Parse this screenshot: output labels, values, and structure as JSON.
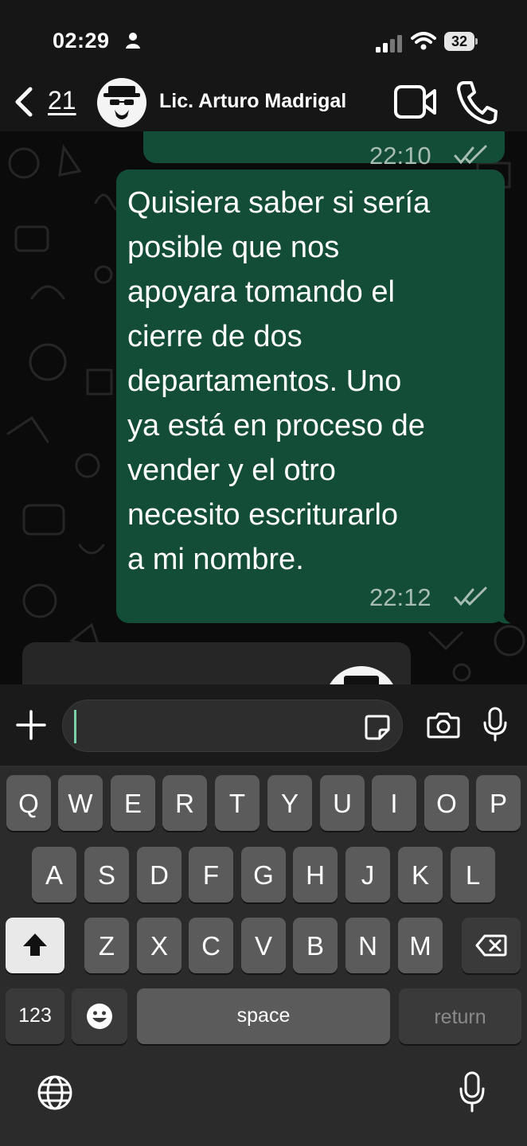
{
  "status_bar": {
    "time": "02:29",
    "battery": "32"
  },
  "header": {
    "back_count": "21",
    "contact_name": "Lic. Arturo Madrigal"
  },
  "messages": [
    {
      "direction": "outgoing",
      "time": "22:10",
      "status": "read"
    },
    {
      "direction": "outgoing",
      "lines": [
        "Quisiera saber si sería",
        "posible que nos",
        "apoyara tomando el",
        "cierre de dos",
        "departamentos. Uno",
        "ya está en proceso de",
        "vender  y el otro",
        "necesito escriturarlo",
        "a mi nombre."
      ],
      "time": "22:12",
      "status": "read"
    },
    {
      "direction": "incoming",
      "partially_visible": true
    }
  ],
  "composer": {
    "value": ""
  },
  "keyboard": {
    "row1": [
      "Q",
      "W",
      "E",
      "R",
      "T",
      "Y",
      "U",
      "I",
      "O",
      "P"
    ],
    "row2": [
      "A",
      "S",
      "D",
      "F",
      "G",
      "H",
      "J",
      "K",
      "L"
    ],
    "row3": [
      "Z",
      "X",
      "C",
      "V",
      "B",
      "N",
      "M"
    ],
    "numbers_label": "123",
    "space_label": "space",
    "return_label": "return"
  },
  "colors": {
    "outgoing_bubble": "#144d37",
    "incoming_bubble": "#262626",
    "background": "#0b0b0b"
  },
  "icons": [
    "back-chevron",
    "video-camera",
    "phone",
    "plus",
    "sticker",
    "camera",
    "microphone",
    "emoji",
    "shift",
    "delete",
    "globe"
  ]
}
